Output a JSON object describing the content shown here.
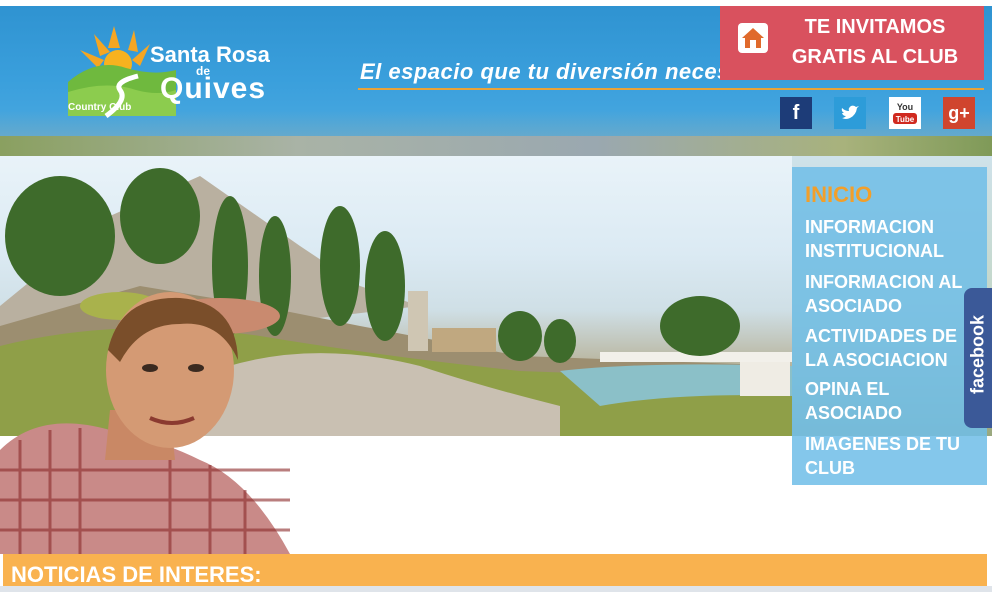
{
  "header": {
    "logo": {
      "name_line1": "Santa Rosa",
      "name_de": "de",
      "name_line2": "Quives",
      "subtitle": "Country Club"
    },
    "slogan": "El espacio que tu diversión necesita!",
    "invite_button": {
      "label": "TE INVITAMOS GRATIS AL CLUB",
      "icon": "home-icon"
    },
    "social": [
      {
        "name": "facebook",
        "icon": "facebook-icon",
        "glyph": "f"
      },
      {
        "name": "twitter",
        "icon": "twitter-icon",
        "glyph": "t"
      },
      {
        "name": "youtube",
        "icon": "youtube-icon",
        "glyph": "You Tube"
      },
      {
        "name": "google-plus",
        "icon": "google-plus-icon",
        "glyph": "g+"
      }
    ]
  },
  "nav": {
    "items": [
      {
        "label": "INICIO",
        "active": true
      },
      {
        "label": "INFORMACION INSTITUCIONAL"
      },
      {
        "label": "INFORMACION AL ASOCIADO"
      },
      {
        "label": "ACTIVIDADES DE LA ASOCIACION"
      },
      {
        "label": "OPINA EL ASOCIADO"
      },
      {
        "label": "IMAGENES DE TU CLUB"
      }
    ]
  },
  "facebook_tab": {
    "label": "facebook"
  },
  "news": {
    "title": "NOTICIAS DE INTERES:"
  },
  "colors": {
    "header_blue": "#2f93d1",
    "invite_red": "#d9515e",
    "nav_blue": "#70bee8",
    "nav_active": "#f29f2a",
    "news_orange": "#f9b24f"
  }
}
